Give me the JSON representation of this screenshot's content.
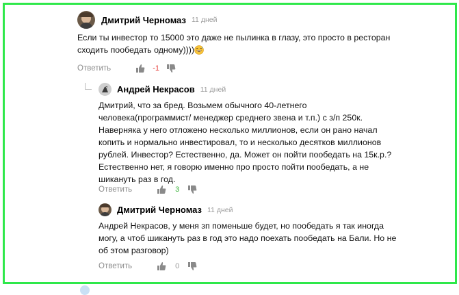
{
  "colors": {
    "frame_border": "#2ee84a",
    "negative": "#e53935",
    "positive": "#3cb43c",
    "muted": "#9a9a9a"
  },
  "comments": [
    {
      "author": "Дмитрий Черномаз",
      "time": "11 дней",
      "text_lines": [
        "Если ты инвестор то 15000 это даже не пылинка в глазу, это просто в ресторан",
        "сходить пообедать одному))))"
      ],
      "emoji": "grinning-sweat-emoji",
      "reply_label": "Ответить",
      "rating": "-1",
      "avatar_icon": "person-photo-avatar"
    },
    {
      "author": "Андрей Некрасов",
      "time": "11 дней",
      "text_lines": [
        "Дмитрий, что за бред. Возьмем обычного 40-летнего",
        "человека(программист/ менеджер среднего звена и т.п.) с з/п 250к.",
        "Наверняка у него отложено несколько миллионов, если он рано начал",
        "копить и нормально инвестировал, то и несколько десятков миллионов",
        "рублей. Инвестор? Естественно, да. Может он пойти пообедать на 15к.р.?",
        "Естественно нет, я говорю именно про просто пойти пообедать, а не",
        "шикануть раз в год."
      ],
      "reply_label": "Ответить",
      "rating": "3",
      "avatar_icon": "bird-avatar"
    },
    {
      "author": "Дмитрий Черномаз",
      "time": "11 дней",
      "text_lines": [
        "Андрей Некрасов, у меня зп поменьше будет, но пообедать я так иногда",
        "могу, а чтоб шикануть раз в год это надо поехать пообедать на Бали. Но не",
        "об этом разговор)"
      ],
      "reply_label": "Ответить",
      "rating": "0",
      "avatar_icon": "person-photo-avatar"
    }
  ]
}
